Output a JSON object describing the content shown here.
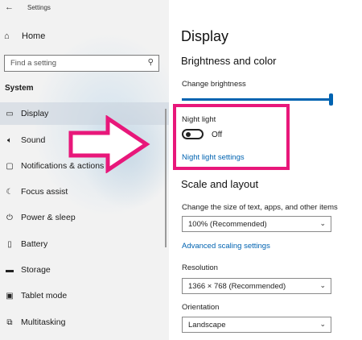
{
  "window": {
    "title": "Settings"
  },
  "sidebar": {
    "home_label": "Home",
    "search_placeholder": "Find a setting",
    "section_label": "System",
    "items": [
      {
        "label": "Display",
        "icon": "monitor-icon",
        "selected": true
      },
      {
        "label": "Sound",
        "icon": "speaker-icon",
        "selected": false
      },
      {
        "label": "Notifications & actions",
        "icon": "notification-icon",
        "selected": false
      },
      {
        "label": "Focus assist",
        "icon": "moon-icon",
        "selected": false
      },
      {
        "label": "Power & sleep",
        "icon": "power-icon",
        "selected": false
      },
      {
        "label": "Battery",
        "icon": "battery-icon",
        "selected": false
      },
      {
        "label": "Storage",
        "icon": "storage-icon",
        "selected": false
      },
      {
        "label": "Tablet mode",
        "icon": "tablet-icon",
        "selected": false
      },
      {
        "label": "Multitasking",
        "icon": "multitasking-icon",
        "selected": false
      }
    ]
  },
  "main": {
    "page_title": "Display",
    "brightness": {
      "heading": "Brightness and color",
      "change_label": "Change brightness",
      "level": 1.0
    },
    "night_light": {
      "label": "Night light",
      "state": "Off",
      "settings_link": "Night light settings"
    },
    "scale": {
      "heading": "Scale and layout",
      "size_label": "Change the size of text, apps, and other items",
      "size_value": "100% (Recommended)",
      "advanced_link": "Advanced scaling settings",
      "resolution_label": "Resolution",
      "resolution_value": "1366 × 768 (Recommended)",
      "orientation_label": "Orientation",
      "orientation_value": "Landscape"
    }
  },
  "annotation": {
    "highlight_color": "#e8177a",
    "arrow_color": "#e8177a"
  },
  "colors": {
    "accent": "#0063b1",
    "sidebar_bg": "#f2f2f2"
  }
}
